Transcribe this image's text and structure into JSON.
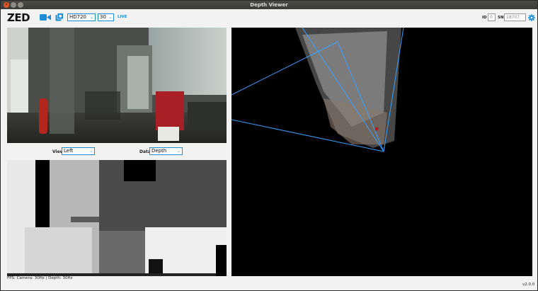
{
  "window": {
    "title": "Depth Viewer",
    "close_glyph": "×"
  },
  "toolbar": {
    "logo": "ZED",
    "camera_icon": "video-camera-icon",
    "record_icon": "record-icon",
    "resolution": "HD720",
    "fps": "30",
    "live": "LIVE",
    "id_label": "ID",
    "id_value": "0",
    "sn_label": "SN",
    "sn_value": "18707"
  },
  "controls": {
    "view_label": "View",
    "view_value": "Left",
    "data_label": "Data",
    "data_value": "Depth"
  },
  "status": {
    "fps_text": "FPS: Camera: 30Hz | Depth: 30Hz",
    "version": "v2.0.0"
  },
  "colors": {
    "accent": "#1e8fd6",
    "frustum": "#3aa0ff"
  }
}
